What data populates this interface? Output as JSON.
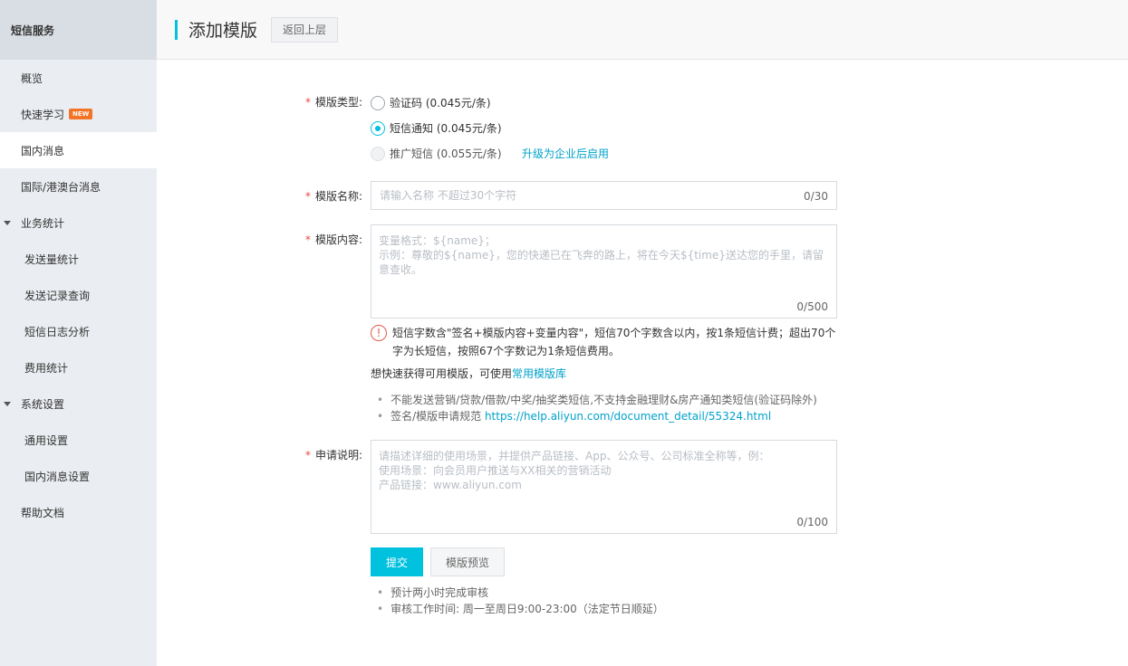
{
  "sidebar": {
    "title": "短信服务",
    "items": [
      {
        "label": "概览"
      },
      {
        "label": "快速学习",
        "badge": "NEW"
      },
      {
        "label": "国内消息"
      },
      {
        "label": "国际/港澳台消息"
      },
      {
        "label": "业务统计"
      },
      {
        "label": "发送量统计"
      },
      {
        "label": "发送记录查询"
      },
      {
        "label": "短信日志分析"
      },
      {
        "label": "费用统计"
      },
      {
        "label": "系统设置"
      },
      {
        "label": "通用设置"
      },
      {
        "label": "国内消息设置"
      },
      {
        "label": "帮助文档"
      }
    ]
  },
  "header": {
    "title": "添加模版",
    "back_label": "返回上层"
  },
  "form": {
    "required_mark": "*",
    "type_label": "模版类型:",
    "types": [
      {
        "label": "验证码 (0.045元/条)",
        "state": "unchecked"
      },
      {
        "label": "短信通知 (0.045元/条)",
        "state": "checked"
      },
      {
        "label": "推广短信 (0.055元/条)",
        "state": "disabled"
      }
    ],
    "upgrade_link": "升级为企业后启用",
    "name_label": "模版名称:",
    "name_placeholder": "请输入名称 不超过30个字符",
    "name_counter": "0/30",
    "content_label": "模版内容:",
    "content_placeholder_line1": "变量格式：${name}；",
    "content_placeholder_line2": " 示例：尊敬的${name}，您的快递已在飞奔的路上，将在今天${time}送达您的手里，请留意查收。",
    "content_counter": "0/500",
    "warn_icon": "!",
    "warn_text": "短信字数含\"签名+模版内容+变量内容\"，短信70个字数含以内，按1条短信计费；超出70个字为长短信，按照67个字数记为1条短信费用。",
    "quick_tip_prefix": "想快速获得可用模版，可使用",
    "quick_tip_link": "常用模版库",
    "rules": [
      {
        "text": "不能发送营销/贷款/借款/中奖/抽奖类短信,不支持金融理财&房产通知类短信(验证码除外)"
      },
      {
        "text": "签名/模版申请规范 ",
        "link": "https://help.aliyun.com/document_detail/55324.html"
      }
    ],
    "desc_label": "申请说明:",
    "desc_placeholder_line1": "请描述详细的使用场景，并提供产品链接、App、公众号、公司标准全称等，例：",
    "desc_placeholder_line2": "使用场景：向会员用户推送与XX相关的营销活动",
    "desc_placeholder_line3": "产品链接：www.aliyun.com",
    "desc_counter": "0/100",
    "submit_label": "提交",
    "preview_label": "模版预览",
    "notes": [
      "预计两小时完成审核",
      "审核工作时间: 周一至周日9:00-23:00（法定节日顺延）"
    ]
  }
}
